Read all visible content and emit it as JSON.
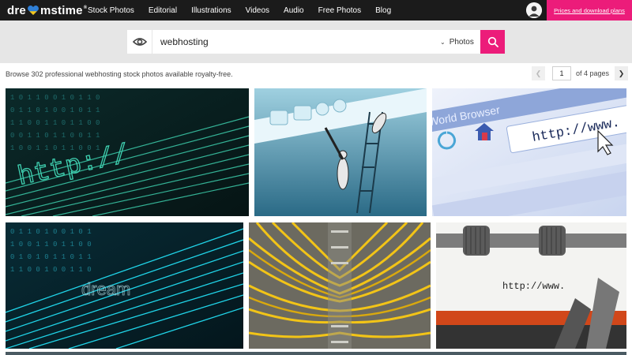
{
  "header": {
    "logo_text_left": "dre",
    "logo_text_right": "mstime",
    "logo_reg": "®",
    "nav": [
      {
        "label": "Stock Photos"
      },
      {
        "label": "Editorial"
      },
      {
        "label": "Illustrations"
      },
      {
        "label": "Videos"
      },
      {
        "label": "Audio"
      },
      {
        "label": "Free Photos"
      },
      {
        "label": "Blog"
      }
    ],
    "cta_label": "Prices and download plans",
    "avatar_icon": "user-avatar-icon"
  },
  "search": {
    "query": "webhosting",
    "type": "Photos",
    "eye_icon": "eye-icon",
    "search_icon": "search-icon"
  },
  "results": {
    "summary": "Browse 302 professional webhosting stock photos available royalty-free.",
    "page_current": "1",
    "page_total_text": "of 4 pages",
    "prev_icon": "chevron-left-icon",
    "next_icon": "chevron-right-icon"
  },
  "images": [
    {
      "subject": "binary digital tunnel with http text",
      "overlay_text": "http://"
    },
    {
      "subject": "workers on ladders painting browser window",
      "overlay_text": ""
    },
    {
      "subject": "web browser address bar",
      "overlay_text": "http://www.",
      "window_label": "World Browser"
    },
    {
      "subject": "cyan binary data lines",
      "overlay_text": "dream"
    },
    {
      "subject": "yellow network cables in server rack",
      "overlay_text": ""
    },
    {
      "subject": "typewriter typing url",
      "overlay_text": "http://www."
    }
  ],
  "colors": {
    "accent": "#ec1c7a",
    "topbar": "#1b1b1b",
    "searchband": "#e6e6e6"
  }
}
